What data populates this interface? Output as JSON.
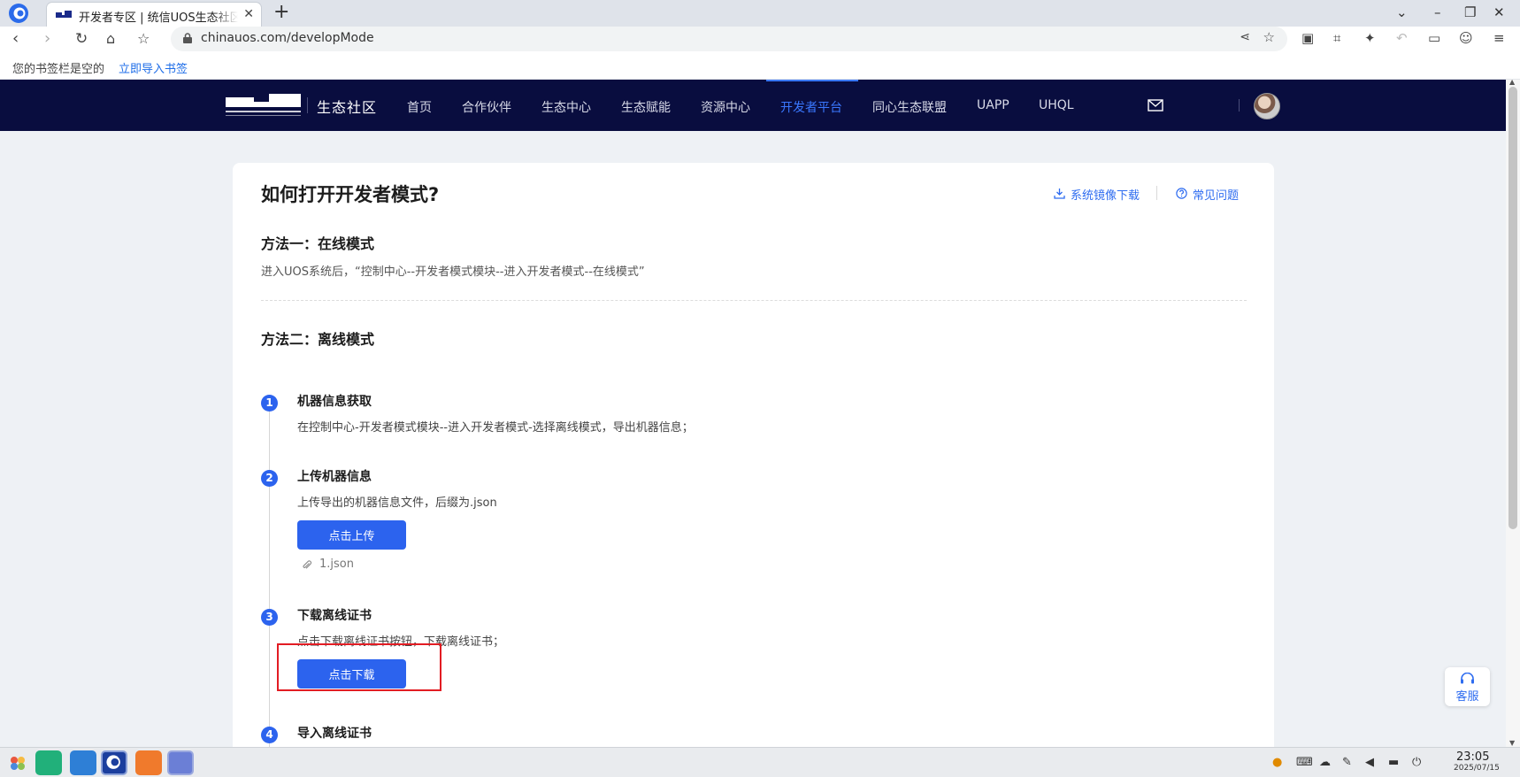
{
  "browser": {
    "tab_title": "开发者专区 | 统信UOS生态社区",
    "tab_close": "✕",
    "new_tab": "+",
    "url": "chinauos.com/developMode",
    "bookmark_empty_text": "您的书签栏是空的",
    "bookmark_import_link": "立即导入书签"
  },
  "site_header": {
    "brand": "生态社区",
    "nav": [
      "首页",
      "合作伙伴",
      "生态中心",
      "生态赋能",
      "资源中心",
      "开发者平台",
      "同心生态联盟",
      "UAPP",
      "UHQL"
    ],
    "active_nav": "开发者平台"
  },
  "page": {
    "title": "如何打开开发者模式?",
    "links": {
      "image_download": "系统镜像下载",
      "faq": "常见问题"
    },
    "method_online": {
      "title": "方法一：在线模式",
      "desc": "进入UOS系统后，“控制中心--开发者模式模块--进入开发者模式--在线模式”"
    },
    "method_offline": {
      "title": "方法二：离线模式"
    },
    "steps": [
      {
        "num": "1",
        "title": "机器信息获取",
        "desc": "在控制中心-开发者模式模块--进入开发者模式-选择离线模式，导出机器信息；"
      },
      {
        "num": "2",
        "title": "上传机器信息",
        "desc": "上传导出的机器信息文件，后缀为.json",
        "button": "点击上传",
        "attachment": "1.json"
      },
      {
        "num": "3",
        "title": "下载离线证书",
        "desc": "点击下载离线证书按钮，下载离线证书；",
        "button": "点击下载"
      },
      {
        "num": "4",
        "title": "导入离线证书"
      }
    ]
  },
  "customer_service": "客服",
  "taskbar": {
    "time": "23:05",
    "date": "2025/07/15"
  },
  "colors": {
    "header_bg": "#090d3f",
    "accent": "#2c63ee",
    "link": "#2e6cf0",
    "highlight": "#e21c23"
  }
}
